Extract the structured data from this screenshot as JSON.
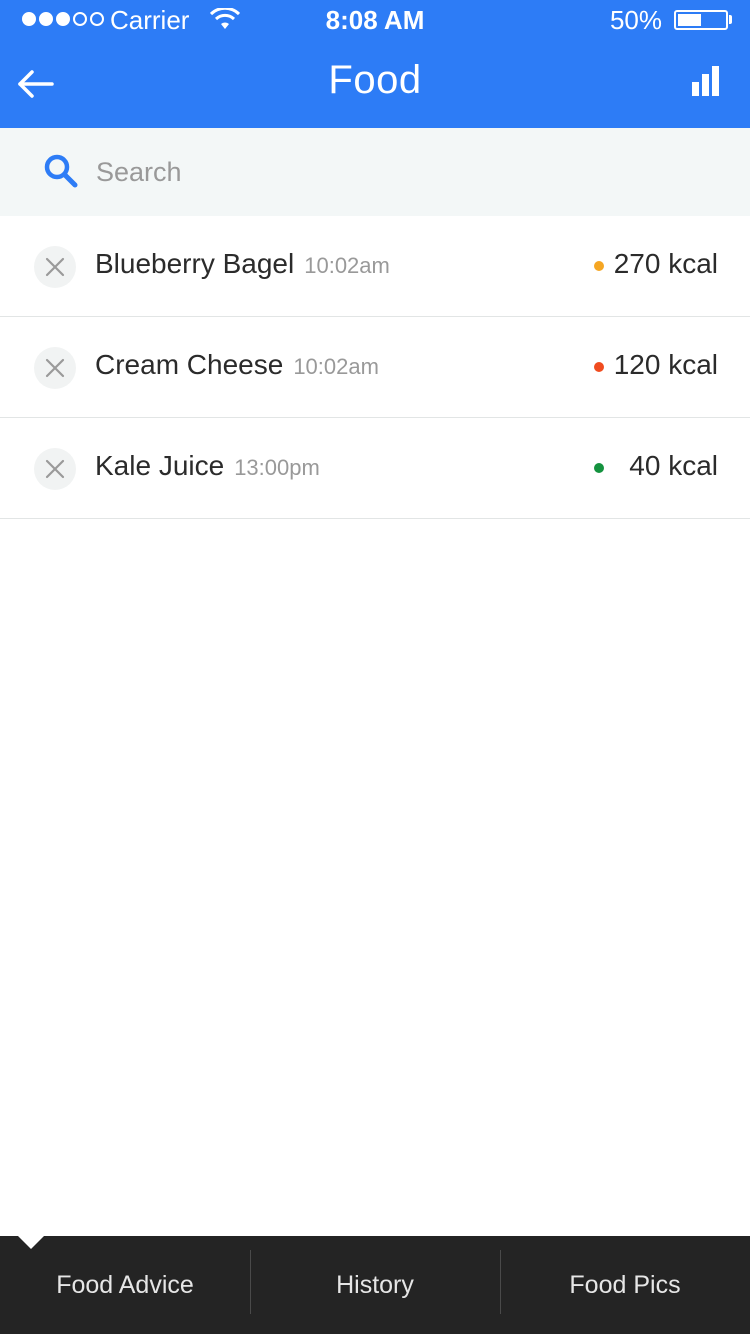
{
  "status_bar": {
    "carrier": "Carrier",
    "time": "8:08 AM",
    "battery": "50%",
    "signal_filled": 3,
    "signal_total": 5,
    "battery_level": 0.5
  },
  "header": {
    "title": "Food",
    "back_icon": "arrow-left-icon",
    "chart_icon": "bar-chart-icon",
    "color": "#2d7cf6"
  },
  "search": {
    "placeholder": "Search",
    "value": ""
  },
  "items": [
    {
      "name": "Blueberry Bagel",
      "time": "10:02am",
      "kcal": "270 kcal",
      "status_color": "#f5a623"
    },
    {
      "name": "Cream Cheese",
      "time": "10:02am",
      "kcal": "120 kcal",
      "status_color": "#f04c1f"
    },
    {
      "name": "Kale Juice",
      "time": "13:00pm",
      "kcal": "40 kcal",
      "status_color": "#14923f"
    }
  ],
  "tabs": [
    {
      "label": "Food Advice",
      "selected": true
    },
    {
      "label": "History",
      "selected": false
    },
    {
      "label": "Food Pics",
      "selected": false
    }
  ]
}
